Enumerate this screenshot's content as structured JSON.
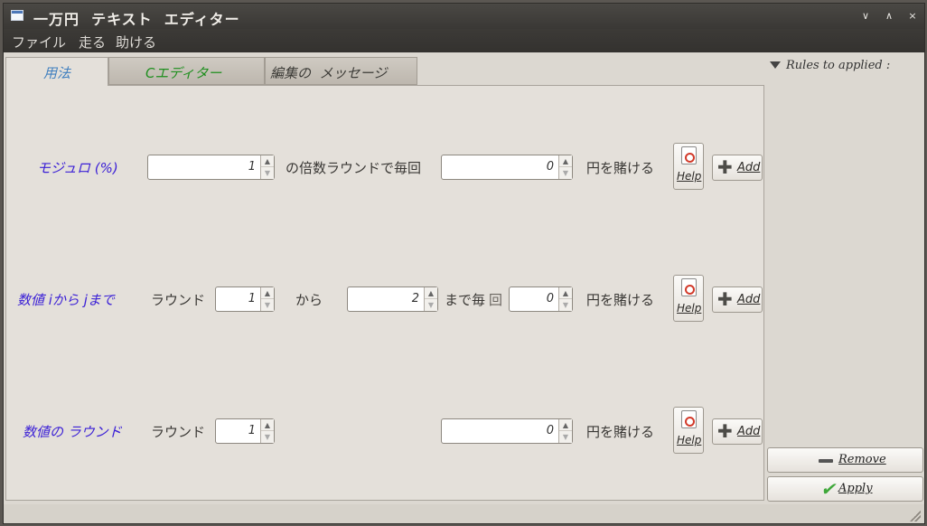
{
  "window": {
    "title": "一万円  テキスト  エディター",
    "controls": [
      "∨",
      "∧",
      "×"
    ]
  },
  "menu": [
    "ファイル",
    "走る",
    "助ける"
  ],
  "tabs": [
    "用法",
    "Cエディター",
    "編集の  メッセージ"
  ],
  "rows": [
    {
      "label": "モジュロ (%)",
      "spin1": "1",
      "middle": "の倍数ラウンドで毎回",
      "spin2": "0",
      "suffix": "円を賭ける",
      "help": "Help",
      "add": "Add"
    },
    {
      "label": "数値 iから jまで",
      "round_label": "ラウンド",
      "spin1": "1",
      "from": "から",
      "spin2": "2",
      "until_prefix": "まで毎",
      "until_suffix": "回",
      "spin3": "0",
      "suffix": "円を賭ける",
      "help": "Help",
      "add": "Add"
    },
    {
      "label": "数値の ラウンド",
      "round_label": "ラウンド",
      "spin1": "1",
      "spin2": "0",
      "suffix": "円を賭ける",
      "help": "Help",
      "add": "Add"
    }
  ],
  "side": {
    "header": "Rules to applied :",
    "remove": "Remove",
    "apply": "Apply"
  },
  "colors": {
    "accent_blue": "#3a1fd6",
    "active_tab": "#3f7fbf",
    "c_tab": "#1f8f1f"
  }
}
